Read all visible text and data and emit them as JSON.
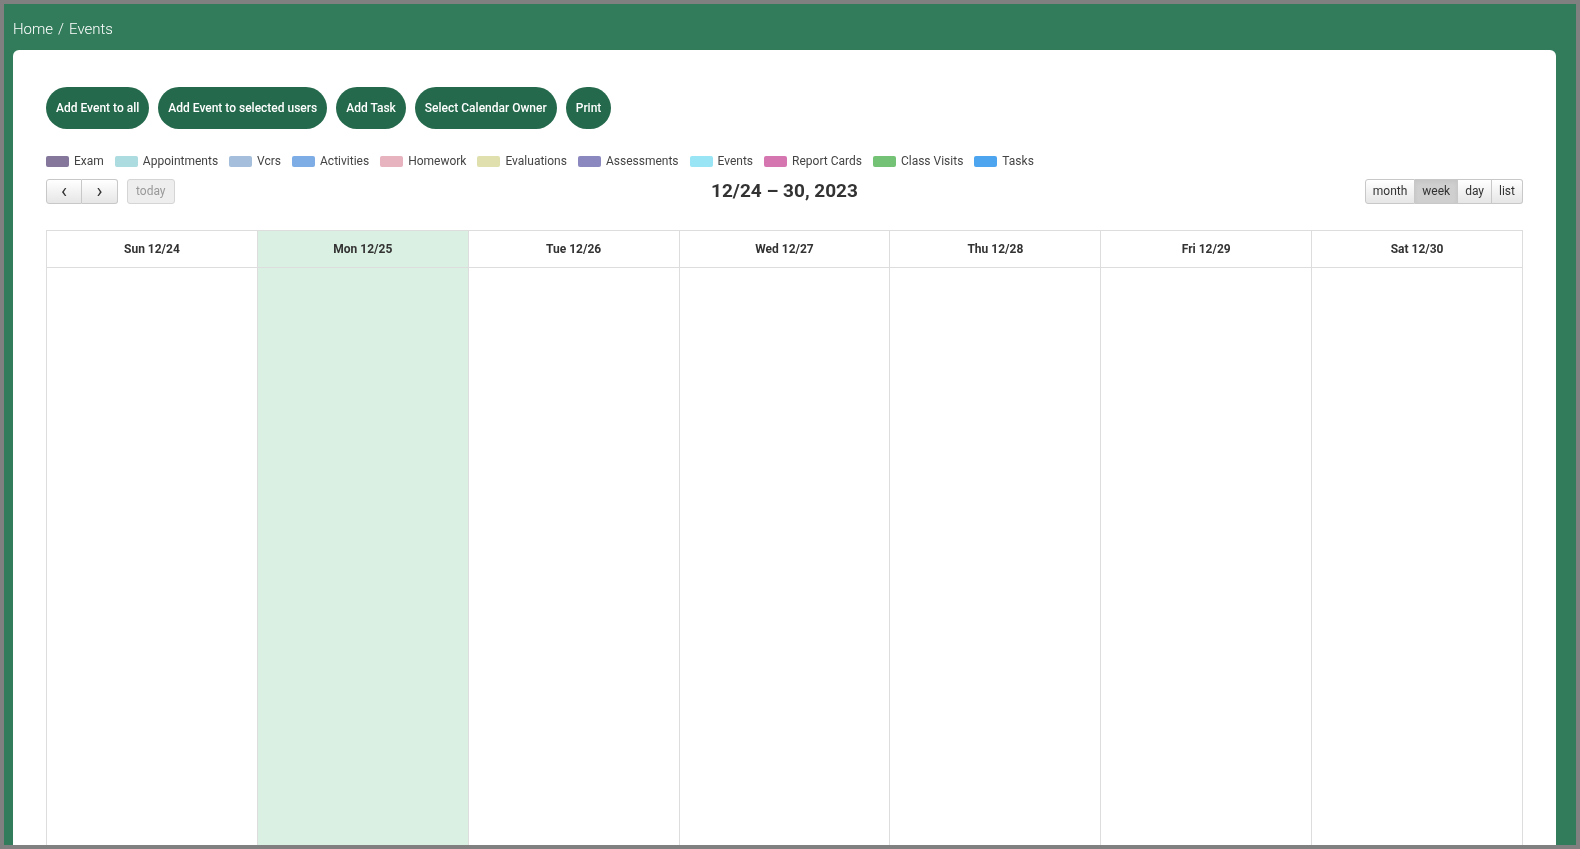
{
  "breadcrumb": [
    "Home",
    "Events"
  ],
  "breadcrumb_separator": "/",
  "buttons": [
    "Add Event to all",
    "Add Event to selected users",
    "Add Task",
    "Select Calendar Owner",
    "Print"
  ],
  "legend": [
    {
      "label": "Exam",
      "color": "#85769c"
    },
    {
      "label": "Appointments",
      "color": "#acdbe0"
    },
    {
      "label": "Vcrs",
      "color": "#a4bedb"
    },
    {
      "label": "Activities",
      "color": "#7eade6"
    },
    {
      "label": "Homework",
      "color": "#e6b3bf"
    },
    {
      "label": "Evaluations",
      "color": "#e0e0ae"
    },
    {
      "label": "Assessments",
      "color": "#8b87bf"
    },
    {
      "label": "Events",
      "color": "#99e5f5"
    },
    {
      "label": "Report Cards",
      "color": "#d576b1"
    },
    {
      "label": "Class Visits",
      "color": "#73c275"
    },
    {
      "label": "Tasks",
      "color": "#4ea5ef"
    }
  ],
  "nav": {
    "prev": "‹",
    "next": "›",
    "today": "today",
    "today_disabled": true
  },
  "title": "12/24 – 30, 2023",
  "views": [
    {
      "label": "month",
      "selected": false
    },
    {
      "label": "week",
      "selected": true
    },
    {
      "label": "day",
      "selected": false
    },
    {
      "label": "list",
      "selected": false
    }
  ],
  "days": [
    {
      "label": "Sun 12/24",
      "today": false
    },
    {
      "label": "Mon 12/25",
      "today": true
    },
    {
      "label": "Tue 12/26",
      "today": false
    },
    {
      "label": "Wed 12/27",
      "today": false
    },
    {
      "label": "Thu 12/28",
      "today": false
    },
    {
      "label": "Fri 12/29",
      "today": false
    },
    {
      "label": "Sat 12/30",
      "today": false
    }
  ]
}
